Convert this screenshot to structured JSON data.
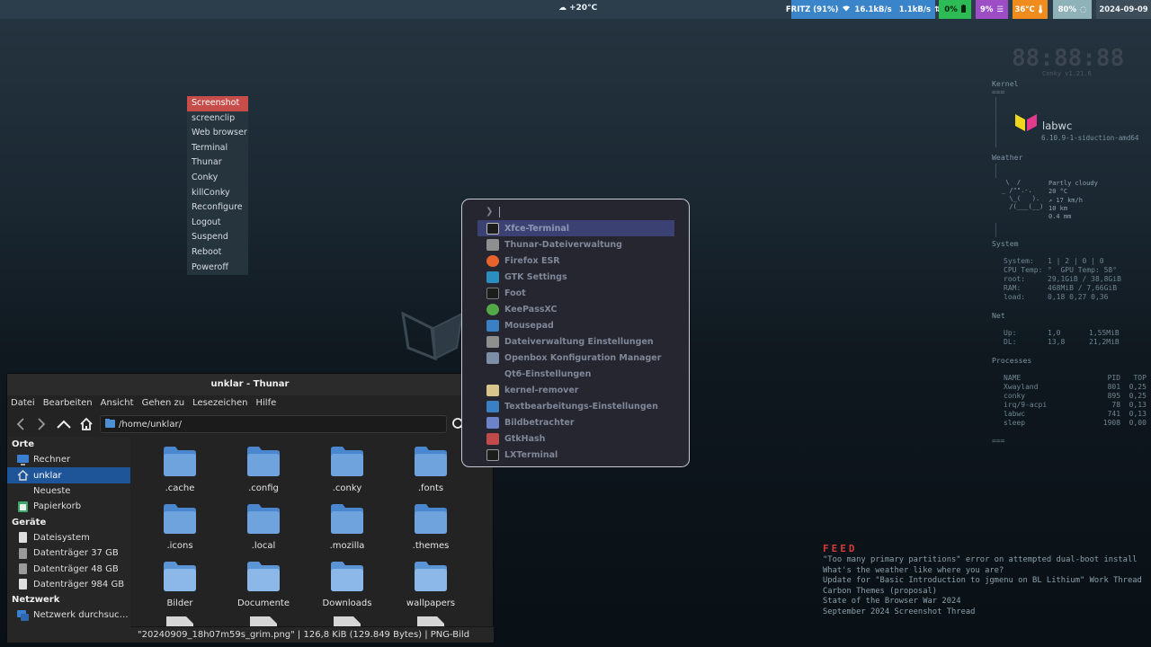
{
  "topbar": {
    "weather": "+20°C",
    "network": "FRITZ (91%)",
    "net_down": "16.1kB/s",
    "net_up": "1.1kB/s",
    "battery": "0%",
    "cpu": "9%",
    "temp": "36°C",
    "memory": "80%",
    "date": "2024-09-09",
    "colors": {
      "net": "#3a84c9",
      "battery": "#2dbb55",
      "cpu": "#9d4ec7",
      "temp": "#f08b1d",
      "memory": "#8fb1b8"
    }
  },
  "root_menu": {
    "items": [
      "Screenshot",
      "screenclip",
      "Web browser",
      "Terminal",
      "Thunar",
      "Conky",
      "killConky",
      "Reconfigure",
      "Logout",
      "Suspend",
      "Reboot",
      "Poweroff"
    ],
    "active": "Screenshot",
    "accent": "#c74d4b"
  },
  "thunar": {
    "title": "unklar - Thunar",
    "menus": [
      "Datei",
      "Bearbeiten",
      "Ansicht",
      "Gehen zu",
      "Lesezeichen",
      "Hilfe"
    ],
    "path": "/home/unklar/",
    "sidebar": {
      "places_header": "Orte",
      "places": [
        {
          "label": "Rechner",
          "icon": "computer-icon"
        },
        {
          "label": "unklar",
          "icon": "home-icon"
        },
        {
          "label": "Neueste",
          "icon": "recent-icon"
        },
        {
          "label": "Papierkorb",
          "icon": "trash-icon"
        }
      ],
      "devices_header": "Geräte",
      "devices": [
        {
          "label": "Dateisystem",
          "icon": "drive-icon"
        },
        {
          "label": "Datenträger 37 GB",
          "icon": "drive-icon"
        },
        {
          "label": "Datenträger 48 GB",
          "icon": "drive-icon"
        },
        {
          "label": "Datenträger 984 GB",
          "icon": "drive-icon"
        }
      ],
      "network_header": "Netzwerk",
      "network": [
        {
          "label": "Netzwerk durchsuc…",
          "icon": "network-icon"
        }
      ],
      "selected": "unklar"
    },
    "files": [
      ".cache",
      ".config",
      ".conky",
      ".fonts",
      ".icons",
      ".local",
      ".mozilla",
      ".themes",
      "Bilder",
      "Documente",
      "Downloads",
      "wallpapers"
    ],
    "status": "\"20240909_18h07m59s_grim.png\"  |  126,8 KiB (129.849 Bytes)  |  PNG-Bild"
  },
  "launcher": {
    "prompt": "❯",
    "items": [
      {
        "label": "Xfce-Terminal",
        "icon": "terminal-icon"
      },
      {
        "label": "Thunar-Dateiverwaltung",
        "icon": "file-manager-icon"
      },
      {
        "label": "Firefox ESR",
        "icon": "firefox-icon"
      },
      {
        "label": "GTK Settings",
        "icon": "settings-icon"
      },
      {
        "label": "Foot",
        "icon": "terminal-icon"
      },
      {
        "label": "KeePassXC",
        "icon": "keepass-icon"
      },
      {
        "label": "Mousepad",
        "icon": "editor-icon"
      },
      {
        "label": "Dateiverwaltung Einstellungen",
        "icon": "file-manager-icon"
      },
      {
        "label": "Openbox Konfiguration Manager",
        "icon": "openbox-icon"
      },
      {
        "label": "Qt6-Einstellungen",
        "icon": "qt-icon"
      },
      {
        "label": "kernel-remover",
        "icon": "kernel-icon"
      },
      {
        "label": "Textbearbeitungs-Einstellungen",
        "icon": "editor-icon"
      },
      {
        "label": "Bildbetrachter",
        "icon": "image-viewer-icon"
      },
      {
        "label": "GtkHash",
        "icon": "hash-icon"
      },
      {
        "label": "LXTerminal",
        "icon": "terminal-icon"
      }
    ],
    "selected": "Xfce-Terminal"
  },
  "conky": {
    "clock": "88:88:88",
    "version": "Conky v1.21.6",
    "kernel_header": "Kernel",
    "wm_name": "labwc",
    "kernel": "6.10.9-1-siduction-amd64",
    "weather_header": "Weather",
    "weather_art": " \\  /\n_ /\"\".-.\n  \\_(   ).\n  /(___(__)",
    "weather_lines": "Partly cloudy\n20 °C\n↗ 17 km/h\n10 km\n0.4 mm",
    "system_header": "System",
    "system_labels": "System:\nCPU Temp:\nroot:\nRAM:\nload:",
    "system_values": "1 | 2 | 0 | 0\n°  GPU Temp: 58°\n29,1GiB / 38,8GiB\n468MiB / 7,66GiB\n0,18 0,27 0,36",
    "net_header": "Net",
    "net_labels": "Up:\nDL:",
    "net_col1": "1,0\n13,8",
    "net_col2": "1,55MiB\n21,2MiB",
    "processes_header": "Processes",
    "proc_header_row": "NAME                    PID   TOP",
    "processes": "Xwayland                801  0,25\nconky                   895  0,25\nirq/9-acpi               78  0,13\nlabwc                   741  0,13\nsleep                  1908  0,00",
    "sep": "==="
  },
  "feed": {
    "title": "FEED",
    "items": [
      "\"Too many primary partitions\" error on attempted dual-boot install",
      "What's the weather like where you are?",
      "Update for \"Basic Introduction to jgmenu on BL Lithium\" Work Thread",
      "Carbon Themes (proposal)",
      "State of the Browser War 2024",
      "September 2024 Screenshot Thread"
    ],
    "accent": "#d53a3a"
  }
}
